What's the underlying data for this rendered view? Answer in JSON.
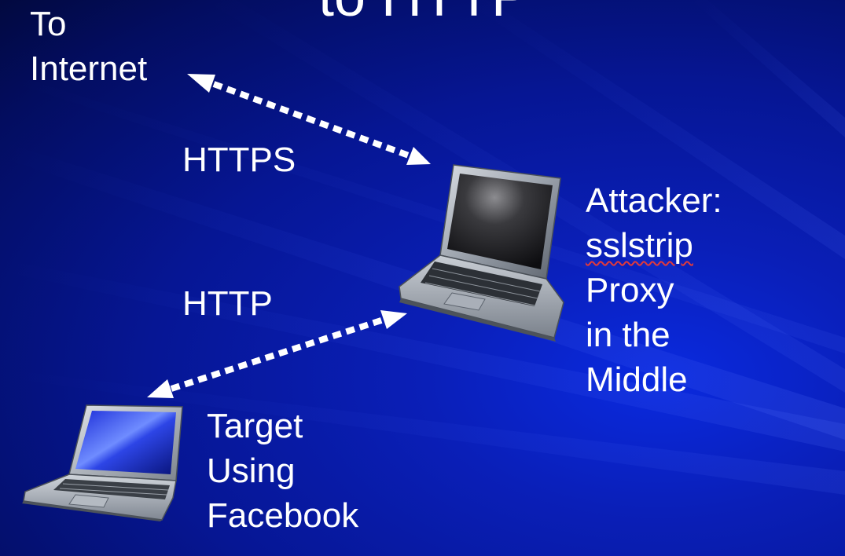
{
  "slide": {
    "title_fragment": "to HTTP"
  },
  "internet": {
    "line1": "To",
    "line2": "Internet"
  },
  "links": {
    "upper": "HTTPS",
    "lower": "HTTP"
  },
  "attacker": {
    "line1": "Attacker:",
    "line2": "sslstrip",
    "line3": "Proxy",
    "line4": "in the",
    "line5": "Middle"
  },
  "target": {
    "line1": "Target",
    "line2": "Using",
    "line3": "Facebook"
  },
  "colors": {
    "background": "#061694",
    "text": "#ffffff",
    "spell_underline": "#e23a3a"
  },
  "icons": {
    "attacker_device": "laptop-icon",
    "target_device": "laptop-icon",
    "links": "dotted-double-arrow-icon"
  }
}
